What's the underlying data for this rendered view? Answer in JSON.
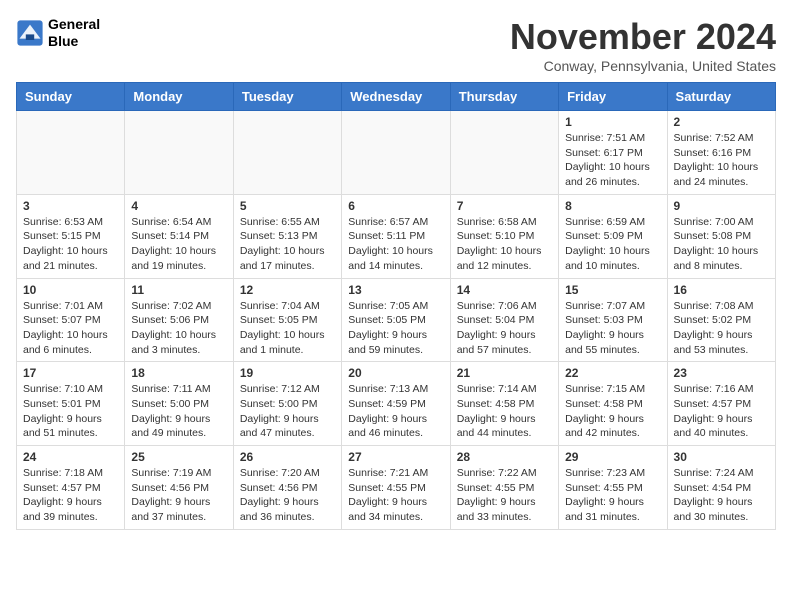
{
  "header": {
    "logo_line1": "General",
    "logo_line2": "Blue",
    "month": "November 2024",
    "location": "Conway, Pennsylvania, United States"
  },
  "weekdays": [
    "Sunday",
    "Monday",
    "Tuesday",
    "Wednesday",
    "Thursday",
    "Friday",
    "Saturday"
  ],
  "weeks": [
    [
      {
        "day": "",
        "info": ""
      },
      {
        "day": "",
        "info": ""
      },
      {
        "day": "",
        "info": ""
      },
      {
        "day": "",
        "info": ""
      },
      {
        "day": "",
        "info": ""
      },
      {
        "day": "1",
        "info": "Sunrise: 7:51 AM\nSunset: 6:17 PM\nDaylight: 10 hours and 26 minutes."
      },
      {
        "day": "2",
        "info": "Sunrise: 7:52 AM\nSunset: 6:16 PM\nDaylight: 10 hours and 24 minutes."
      }
    ],
    [
      {
        "day": "3",
        "info": "Sunrise: 6:53 AM\nSunset: 5:15 PM\nDaylight: 10 hours and 21 minutes."
      },
      {
        "day": "4",
        "info": "Sunrise: 6:54 AM\nSunset: 5:14 PM\nDaylight: 10 hours and 19 minutes."
      },
      {
        "day": "5",
        "info": "Sunrise: 6:55 AM\nSunset: 5:13 PM\nDaylight: 10 hours and 17 minutes."
      },
      {
        "day": "6",
        "info": "Sunrise: 6:57 AM\nSunset: 5:11 PM\nDaylight: 10 hours and 14 minutes."
      },
      {
        "day": "7",
        "info": "Sunrise: 6:58 AM\nSunset: 5:10 PM\nDaylight: 10 hours and 12 minutes."
      },
      {
        "day": "8",
        "info": "Sunrise: 6:59 AM\nSunset: 5:09 PM\nDaylight: 10 hours and 10 minutes."
      },
      {
        "day": "9",
        "info": "Sunrise: 7:00 AM\nSunset: 5:08 PM\nDaylight: 10 hours and 8 minutes."
      }
    ],
    [
      {
        "day": "10",
        "info": "Sunrise: 7:01 AM\nSunset: 5:07 PM\nDaylight: 10 hours and 6 minutes."
      },
      {
        "day": "11",
        "info": "Sunrise: 7:02 AM\nSunset: 5:06 PM\nDaylight: 10 hours and 3 minutes."
      },
      {
        "day": "12",
        "info": "Sunrise: 7:04 AM\nSunset: 5:05 PM\nDaylight: 10 hours and 1 minute."
      },
      {
        "day": "13",
        "info": "Sunrise: 7:05 AM\nSunset: 5:05 PM\nDaylight: 9 hours and 59 minutes."
      },
      {
        "day": "14",
        "info": "Sunrise: 7:06 AM\nSunset: 5:04 PM\nDaylight: 9 hours and 57 minutes."
      },
      {
        "day": "15",
        "info": "Sunrise: 7:07 AM\nSunset: 5:03 PM\nDaylight: 9 hours and 55 minutes."
      },
      {
        "day": "16",
        "info": "Sunrise: 7:08 AM\nSunset: 5:02 PM\nDaylight: 9 hours and 53 minutes."
      }
    ],
    [
      {
        "day": "17",
        "info": "Sunrise: 7:10 AM\nSunset: 5:01 PM\nDaylight: 9 hours and 51 minutes."
      },
      {
        "day": "18",
        "info": "Sunrise: 7:11 AM\nSunset: 5:00 PM\nDaylight: 9 hours and 49 minutes."
      },
      {
        "day": "19",
        "info": "Sunrise: 7:12 AM\nSunset: 5:00 PM\nDaylight: 9 hours and 47 minutes."
      },
      {
        "day": "20",
        "info": "Sunrise: 7:13 AM\nSunset: 4:59 PM\nDaylight: 9 hours and 46 minutes."
      },
      {
        "day": "21",
        "info": "Sunrise: 7:14 AM\nSunset: 4:58 PM\nDaylight: 9 hours and 44 minutes."
      },
      {
        "day": "22",
        "info": "Sunrise: 7:15 AM\nSunset: 4:58 PM\nDaylight: 9 hours and 42 minutes."
      },
      {
        "day": "23",
        "info": "Sunrise: 7:16 AM\nSunset: 4:57 PM\nDaylight: 9 hours and 40 minutes."
      }
    ],
    [
      {
        "day": "24",
        "info": "Sunrise: 7:18 AM\nSunset: 4:57 PM\nDaylight: 9 hours and 39 minutes."
      },
      {
        "day": "25",
        "info": "Sunrise: 7:19 AM\nSunset: 4:56 PM\nDaylight: 9 hours and 37 minutes."
      },
      {
        "day": "26",
        "info": "Sunrise: 7:20 AM\nSunset: 4:56 PM\nDaylight: 9 hours and 36 minutes."
      },
      {
        "day": "27",
        "info": "Sunrise: 7:21 AM\nSunset: 4:55 PM\nDaylight: 9 hours and 34 minutes."
      },
      {
        "day": "28",
        "info": "Sunrise: 7:22 AM\nSunset: 4:55 PM\nDaylight: 9 hours and 33 minutes."
      },
      {
        "day": "29",
        "info": "Sunrise: 7:23 AM\nSunset: 4:55 PM\nDaylight: 9 hours and 31 minutes."
      },
      {
        "day": "30",
        "info": "Sunrise: 7:24 AM\nSunset: 4:54 PM\nDaylight: 9 hours and 30 minutes."
      }
    ]
  ]
}
